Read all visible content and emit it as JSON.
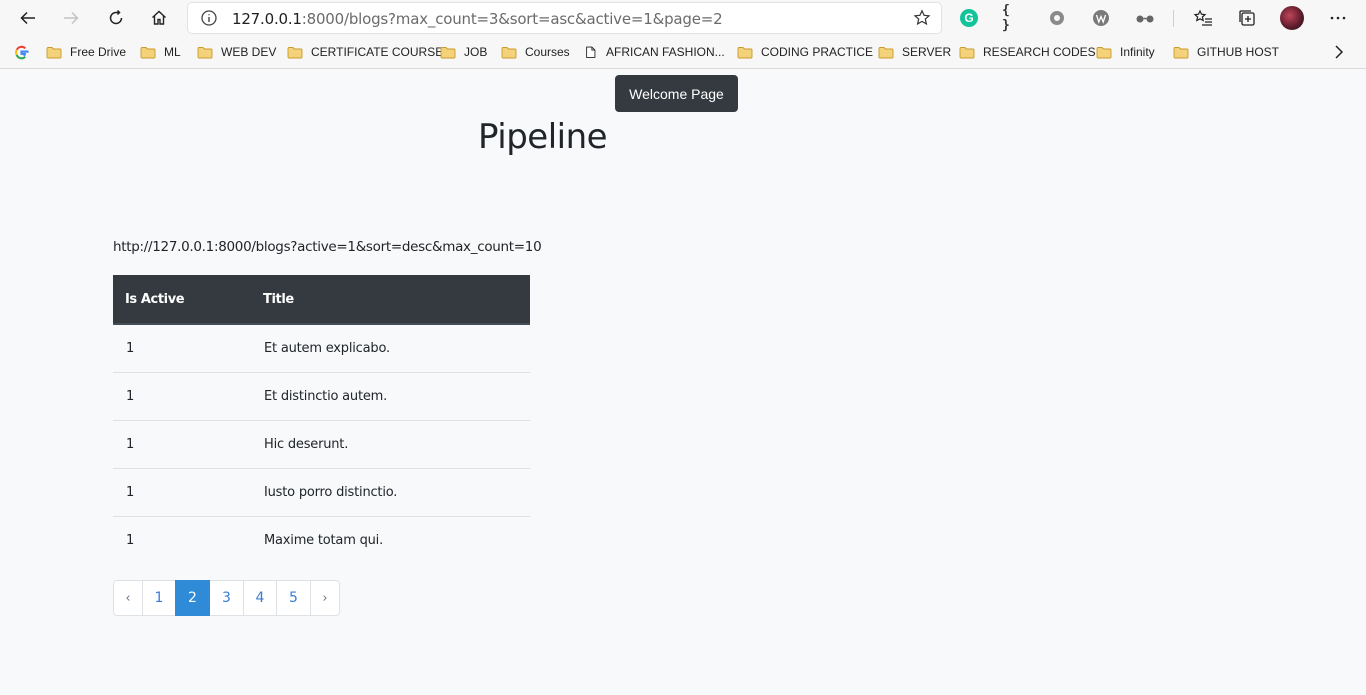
{
  "browser": {
    "url_host": "127.0.0.1",
    "url_rest": ":8000/blogs?max_count=3&sort=asc&active=1&page=2",
    "bookmarks": [
      {
        "label": "Free Drive",
        "icon": "folder-icon"
      },
      {
        "label": "ML",
        "icon": "folder-icon"
      },
      {
        "label": "WEB DEV",
        "icon": "folder-icon"
      },
      {
        "label": "CERTIFICATE COURSE",
        "icon": "folder-icon"
      },
      {
        "label": "JOB",
        "icon": "folder-icon"
      },
      {
        "label": "Courses",
        "icon": "folder-icon"
      },
      {
        "label": "AFRICAN FASHION...",
        "icon": "page-icon"
      },
      {
        "label": "CODING PRACTICE",
        "icon": "folder-icon"
      },
      {
        "label": "SERVER",
        "icon": "folder-icon"
      },
      {
        "label": "RESEARCH CODES",
        "icon": "folder-icon"
      },
      {
        "label": "Infinity",
        "icon": "folder-icon"
      },
      {
        "label": "GITHUB HOST",
        "icon": "folder-icon"
      }
    ],
    "extensions": {
      "grammarly": "G",
      "json_viewer": "{ }"
    }
  },
  "page": {
    "welcome_button": "Welcome Page",
    "title": "Pipeline",
    "link_text": "http://127.0.0.1:8000/blogs?active=1&sort=desc&max_count=10"
  },
  "table": {
    "headers": [
      "Is Active",
      "Title"
    ],
    "rows": [
      [
        "1",
        "Et autem explicabo."
      ],
      [
        "1",
        "Et distinctio autem."
      ],
      [
        "1",
        "Hic deserunt."
      ],
      [
        "1",
        "Iusto porro distinctio."
      ],
      [
        "1",
        "Maxime totam qui."
      ]
    ]
  },
  "pagination": {
    "prev": "‹",
    "pages": [
      "1",
      "2",
      "3",
      "4",
      "5"
    ],
    "active": "2",
    "next": "›"
  },
  "colors": {
    "accent": "#2f8bd8",
    "dark": "#343a40",
    "folder": "#e8b84a"
  }
}
